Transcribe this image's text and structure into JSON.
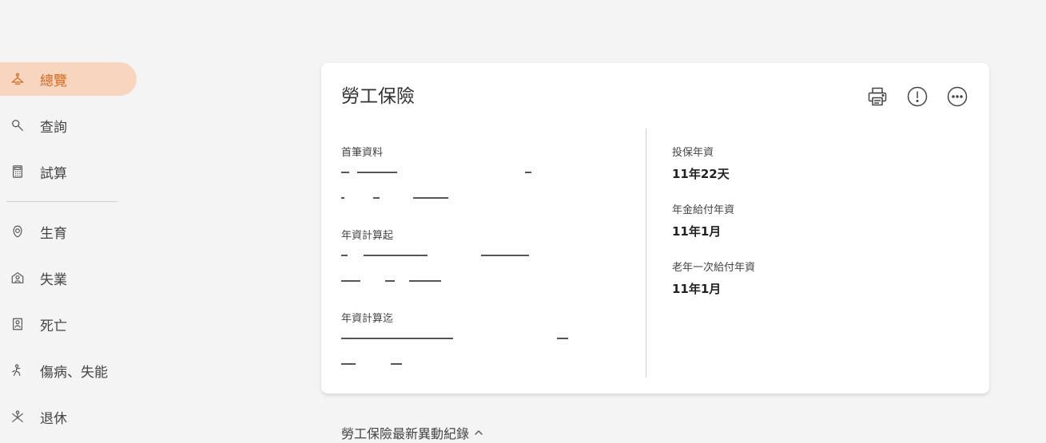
{
  "sidebar": {
    "items": [
      {
        "label": "總覽",
        "icon": "hanger-icon"
      },
      {
        "label": "查詢",
        "icon": "search-icon"
      },
      {
        "label": "試算",
        "icon": "calculator-icon"
      },
      {
        "label": "生育",
        "icon": "baby-icon"
      },
      {
        "label": "失業",
        "icon": "house-person-icon"
      },
      {
        "label": "死亡",
        "icon": "memorial-icon"
      },
      {
        "label": "傷病、失能",
        "icon": "injury-icon"
      },
      {
        "label": "退休",
        "icon": "retire-icon"
      }
    ],
    "active_color": "#f8d5bf",
    "active_text_color": "#d4691e"
  },
  "card": {
    "title": "勞工保險",
    "actions": [
      "printer-icon",
      "info-icon",
      "more-icon"
    ],
    "left": {
      "first_record_label": "首筆資料",
      "start_label": "年資計算起",
      "end_label": "年資計算迄"
    },
    "right": {
      "insured_years_label": "投保年資",
      "insured_years_value": "11年22天",
      "pension_years_label": "年金給付年資",
      "pension_years_value": "11年1月",
      "lump_sum_years_label": "老年一次給付年資",
      "lump_sum_years_value": "11年1月"
    }
  },
  "footer": {
    "link_label": "勞工保險最新異動紀錄"
  }
}
